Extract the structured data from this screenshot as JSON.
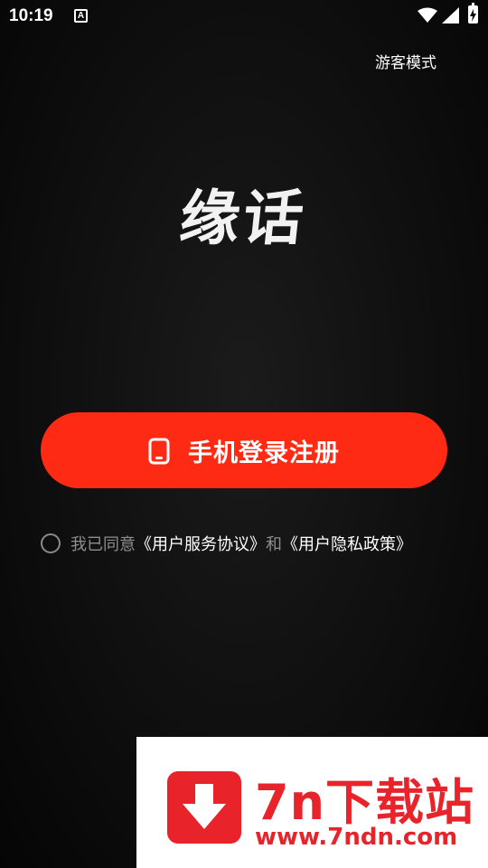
{
  "status_bar": {
    "time": "10:19",
    "notification_letter": "A"
  },
  "header": {
    "guest_mode_label": "游客模式"
  },
  "logo": {
    "text": "缘话"
  },
  "login": {
    "button_label": "手机登录注册"
  },
  "agreement": {
    "prefix": "我已同意",
    "terms_link": "《用户服务协议》",
    "and": "和",
    "privacy_link": "《用户隐私政策》",
    "checked": false
  },
  "watermark": {
    "title": "7n下载站",
    "url": "www.7ndn.com"
  },
  "colors": {
    "accent": "#ff2a14",
    "background": "#111111",
    "muted_text": "#8e8e8e",
    "watermark_red": "#e8232a"
  }
}
